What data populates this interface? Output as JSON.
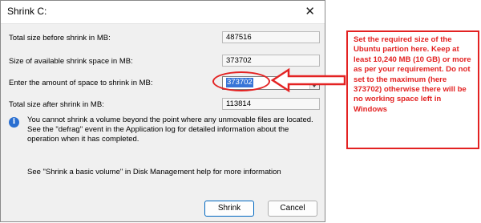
{
  "dialog": {
    "title": "Shrink C:",
    "rows": [
      {
        "label": "Total size before shrink in MB:",
        "value": "487516"
      },
      {
        "label": "Size of available shrink space in MB:",
        "value": "373702"
      },
      {
        "label": "Enter the amount of space to shrink in MB:",
        "value": "373702"
      },
      {
        "label": "Total size after shrink in MB:",
        "value": "113814"
      }
    ],
    "info": "You cannot shrink a volume beyond the point where any unmovable files are located. See the \"defrag\" event in the Application log for detailed information about the operation when it has completed.",
    "help": "See \"Shrink a basic volume\" in Disk Management help for more information",
    "buttons": {
      "shrink": "Shrink",
      "cancel": "Cancel"
    }
  },
  "annotation": {
    "note": "Set the required size of the Ubuntu partion here. Keep at least 10,240 MB (10 GB) or more as per your requirement. Do not set to the maximum (here 373702) otherwise there will be no working space left in Windows",
    "color": "#e32222"
  }
}
